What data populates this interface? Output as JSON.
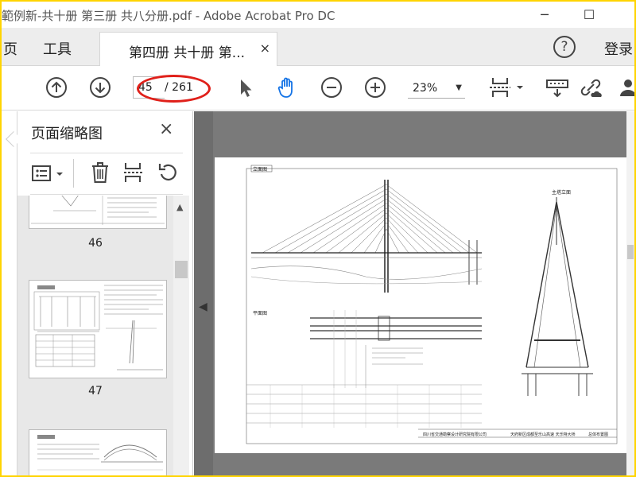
{
  "window": {
    "title": "範例新-共十册 第三册  共八分册.pdf - Adobe Acrobat Pro DC",
    "minimize": "─",
    "maximize": "☐",
    "close": "✕"
  },
  "tabs": {
    "home": "页",
    "tools": "工具",
    "document": "第四册  共十册  第...",
    "close": "×",
    "help": "?",
    "login": "登录"
  },
  "toolbar": {
    "current_page": "45",
    "total_pages": "/ 261",
    "zoom": "23%",
    "zoom_arrow": "▼"
  },
  "sidebar": {
    "title": "页面缩略图",
    "close": "×",
    "thumbnails": [
      {
        "label": "46"
      },
      {
        "label": "47"
      },
      {
        "label": ""
      }
    ]
  },
  "drawing": {
    "elevation_title": "立面图",
    "plan_title": "平面图",
    "tower_title": "主塔立面",
    "company_1": "四川省交通勘察设计研究院有限公司",
    "company_2": "天府新区成都至乐山高速  天乐特大桥",
    "company_3": "总体布置图"
  },
  "colors": {
    "accent": "#1473e6",
    "highlight_ellipse": "#e0201a",
    "frame": "#ffd400"
  }
}
